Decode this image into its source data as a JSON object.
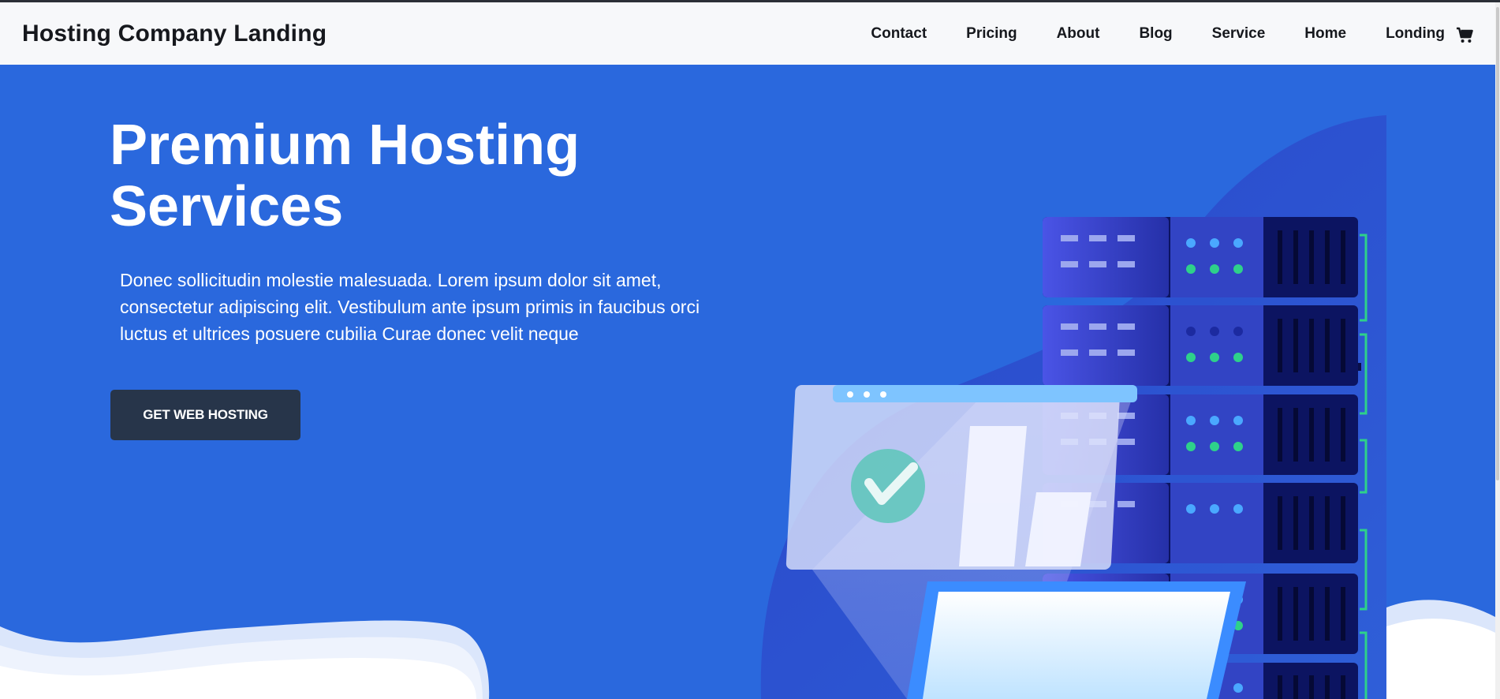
{
  "brand": "Hosting Company Landing",
  "nav": {
    "links": [
      "Contact",
      "Pricing",
      "About",
      "Blog",
      "Service",
      "Home",
      "Londing"
    ],
    "cart_icon": "shopping-cart-icon"
  },
  "hero": {
    "title": "Premium Hosting Services",
    "text": "Donec sollicitudin molestie malesuada. Lorem ipsum dolor sit amet, consectetur adipiscing elit. Vestibulum ante ipsum primis in faucibus orci luctus et ultrices posuere cubilia Curae donec velit neque",
    "cta_label": "GET WEB HOSTING"
  },
  "colors": {
    "hero_bg": "#2a68dd",
    "navbar_bg": "#f7f8fa",
    "cta_bg": "#27354a",
    "server_dark": "#0c1461",
    "led_green": "#2ed18a",
    "led_blue": "#4aa8ff"
  }
}
